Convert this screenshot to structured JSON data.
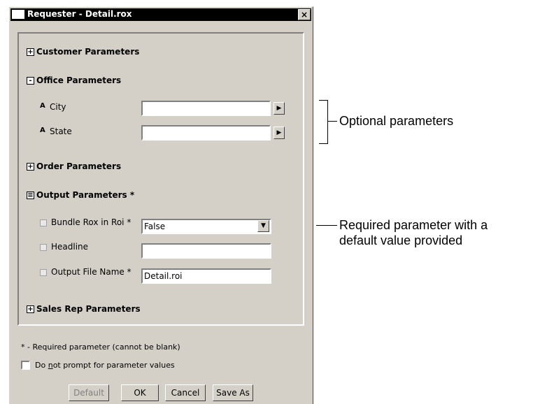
{
  "window": {
    "title": "Requester - Detail.rox",
    "close_label": "×"
  },
  "sections": {
    "customer": {
      "label": "Customer Parameters",
      "toggle": "+"
    },
    "office": {
      "label": "Office Parameters",
      "toggle": "-"
    },
    "order": {
      "label": "Order Parameters",
      "toggle": "+"
    },
    "output": {
      "label": "Output Parameters *",
      "toggle": "≡"
    },
    "sales": {
      "label": "Sales Rep Parameters",
      "toggle": "+"
    }
  },
  "office_params": {
    "city": {
      "label": "City",
      "icon": "A",
      "value": ""
    },
    "state": {
      "label": "State",
      "icon": "A",
      "value": ""
    }
  },
  "output_params": {
    "bundle": {
      "label": "Bundle Rox in Roi *",
      "value": "False"
    },
    "headline": {
      "label": "Headline",
      "value": ""
    },
    "output_file": {
      "label": "Output File Name *",
      "value": "Detail.roi"
    }
  },
  "footnote": "* - Required parameter (cannot be blank)",
  "no_prompt": {
    "label_prefix": "Do ",
    "label_underlined": "n",
    "label_suffix": "ot prompt for parameter values",
    "checked": false
  },
  "buttons": {
    "default": "Default",
    "ok": "OK",
    "cancel": "Cancel",
    "save_as": "Save As"
  },
  "annotations": {
    "optional": "Optional parameters",
    "required_line1": "Required parameter with a",
    "required_line2": "default value provided"
  },
  "icons": {
    "arrow": "▶",
    "dropdown": "▼"
  }
}
